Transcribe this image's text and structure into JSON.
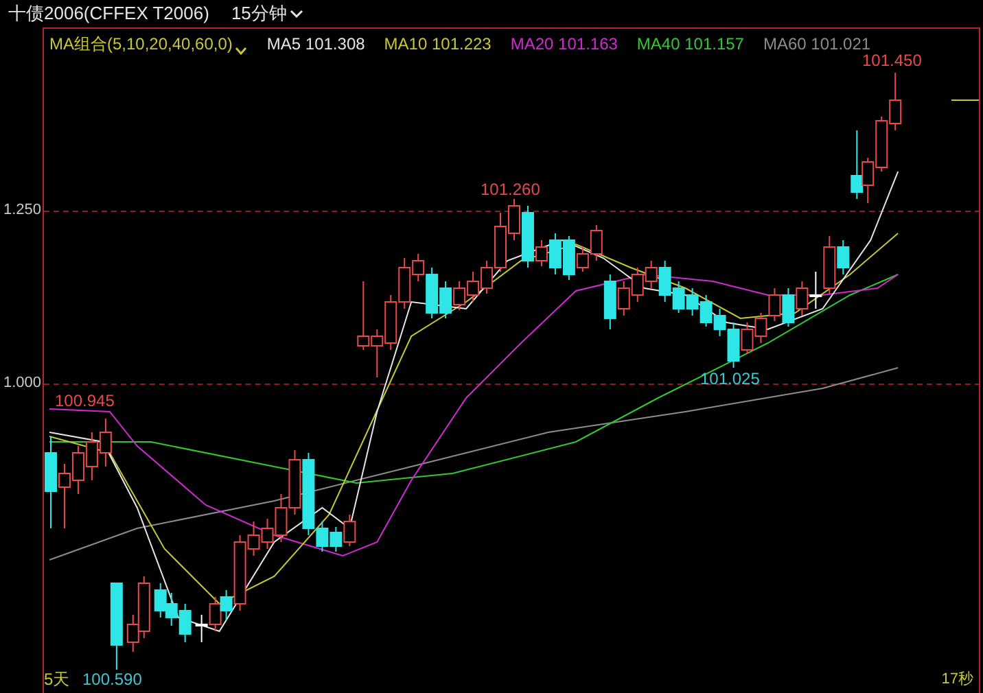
{
  "header": {
    "title": "十债2006(CFFEX T2006)",
    "period": "15分钟"
  },
  "legend": [
    {
      "label": "MA组合(5,10,20,40,60,0)",
      "kind": "selector",
      "color": "#c8c832"
    },
    {
      "label": "MA5 101.308",
      "kind": "value",
      "color": "#e6e6e6"
    },
    {
      "label": "MA10 101.223",
      "kind": "value",
      "color": "#c8c832"
    },
    {
      "label": "MA20 101.163",
      "kind": "value",
      "color": "#d22ad2"
    },
    {
      "label": "MA40 101.157",
      "kind": "value",
      "color": "#32c832"
    },
    {
      "label": "MA60 101.021",
      "kind": "value",
      "color": "#8c8c8c"
    }
  ],
  "y_axis": [
    "1.250",
    "1.000"
  ],
  "annotations": [
    {
      "text": "101.450",
      "kind": "high"
    },
    {
      "text": "101.260",
      "kind": "high"
    },
    {
      "text": "100.945",
      "kind": "high"
    },
    {
      "text": "101.025",
      "kind": "low"
    },
    {
      "text": "100.590",
      "kind": "low"
    }
  ],
  "footer": {
    "range": "5天",
    "countdown": "17秒"
  }
}
